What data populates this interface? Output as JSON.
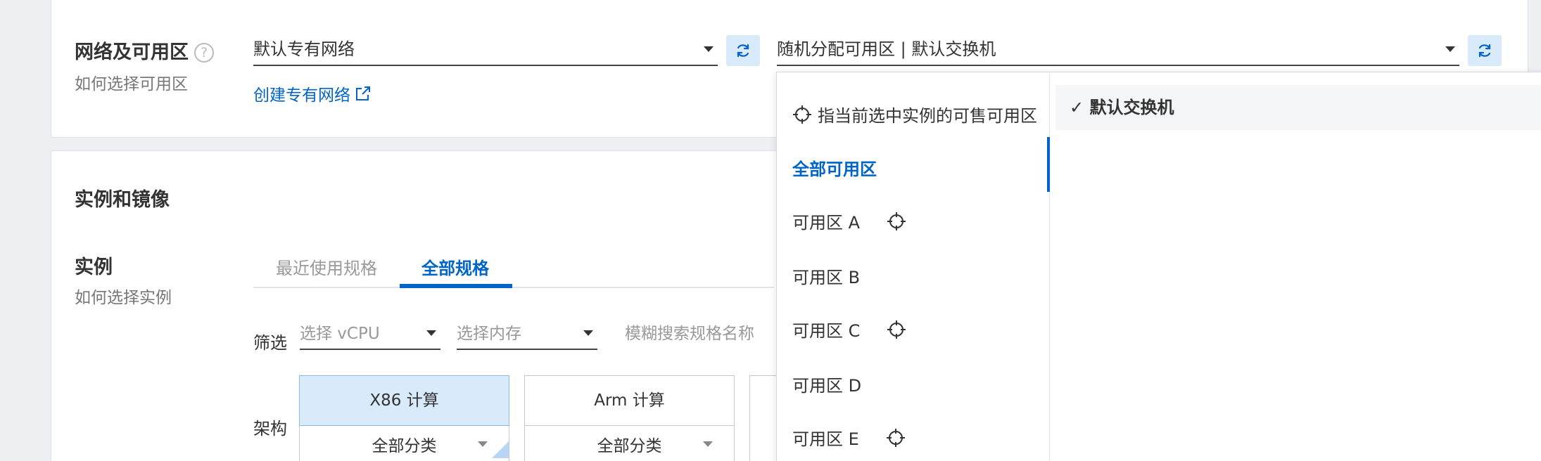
{
  "network": {
    "label": "网络及可用区",
    "help": "?",
    "sub_label": "如何选择可用区",
    "vpc_value": "默认专有网络",
    "create_vpc_link": "创建专有网络",
    "zone_value": "随机分配可用区 | 默认交换机"
  },
  "section": {
    "title": "实例和镜像",
    "instance_label": "实例",
    "instance_sub": "如何选择实例"
  },
  "tabs": [
    {
      "label": "最近使用规格"
    },
    {
      "label": "全部规格"
    }
  ],
  "filter": {
    "label": "筛选",
    "vcpu_placeholder": "选择 vCPU",
    "memory_placeholder": "选择内存",
    "search_placeholder": "模糊搜索规格名称"
  },
  "arch": {
    "label": "架构",
    "options": [
      {
        "name": "X86 计算",
        "sub": "全部分类"
      },
      {
        "name": "Arm 计算",
        "sub": "全部分类"
      }
    ]
  },
  "dropdown": {
    "items": [
      {
        "label": "指当前选中实例的可售可用区"
      },
      {
        "label": "全部可用区"
      },
      {
        "label": "可用区 A"
      },
      {
        "label": "可用区 B"
      },
      {
        "label": "可用区 C"
      },
      {
        "label": "可用区 D"
      },
      {
        "label": "可用区 E"
      }
    ],
    "switch_option": "默认交换机",
    "check": "✓"
  },
  "colors": {
    "accent": "#0064c8",
    "selected_bg": "#d9ebfa"
  }
}
